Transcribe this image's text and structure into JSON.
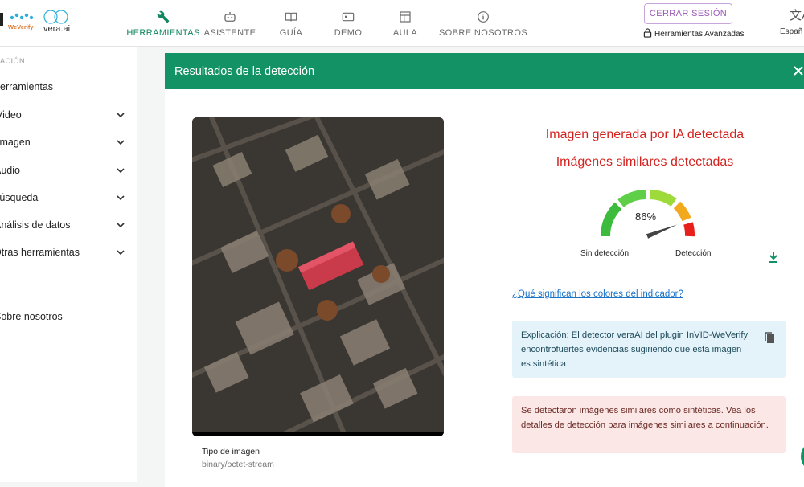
{
  "logos": {
    "weverify": "WeVerify",
    "veraai": "vera.ai"
  },
  "nav": [
    {
      "label": "HERRAMIENTAS",
      "icon": "wrench-icon",
      "active": true
    },
    {
      "label": "ASISTENTE",
      "icon": "robot-icon",
      "active": false
    },
    {
      "label": "GUÍA",
      "icon": "book-icon",
      "active": false
    },
    {
      "label": "DEMO",
      "icon": "video-icon",
      "active": false
    },
    {
      "label": "AULA",
      "icon": "classroom-icon",
      "active": false
    },
    {
      "label": "SOBRE NOSOTROS",
      "icon": "info-icon",
      "active": false
    }
  ],
  "header": {
    "logout_label": "CERRAR SESIÓN",
    "advanced_tools": "Herramientas Avanzadas",
    "language": "Españ"
  },
  "sidebar": {
    "heading": "ACIÓN",
    "items": [
      {
        "label": "Herramientas",
        "expandable": false
      },
      {
        "label": "Video",
        "expandable": true
      },
      {
        "label": "Imagen",
        "expandable": true
      },
      {
        "label": "Audio",
        "expandable": true
      },
      {
        "label": "Búsqueda",
        "expandable": true
      },
      {
        "label": "Análisis de datos",
        "expandable": true
      },
      {
        "label": "Otras herramientas",
        "expandable": true
      },
      {
        "label": "Sobre nosotros",
        "expandable": false
      }
    ]
  },
  "panel": {
    "title": "Resultados de la detección",
    "image_type_label": "Tipo de imagen",
    "image_type_value": "binary/octet-stream",
    "result_primary": "Imagen generada por IA detectada",
    "result_secondary": "Imágenes similares detectadas",
    "gauge_percent": "86%",
    "gauge_value": 0.86,
    "gauge_label_low": "Sin detección",
    "gauge_label_high": "Detección",
    "colors_link": "¿Qué significan los colores del indicador?",
    "explanation": "Explicación: El detector veraAI del plugin InVID-WeVerify encontrofuertes evidencias sugiriendo que esta imagen es sintética",
    "similar_notice": "Se detectaron imágenes similares como sintéticas. Vea los detalles de detección para imágenes similares a continuación."
  },
  "colors": {
    "accent": "#139266",
    "alert_red": "#d3211e",
    "logout_purple": "#9b59b6",
    "link_blue": "#1a73c8"
  }
}
